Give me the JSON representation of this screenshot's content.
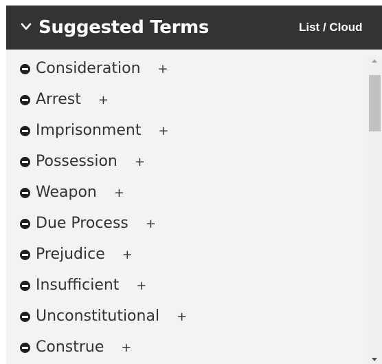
{
  "header": {
    "title": "Suggested Terms",
    "toggle_label": "List / Cloud",
    "collapse_icon": "chevron-down-icon"
  },
  "terms": [
    {
      "label": "Consideration",
      "add": "+"
    },
    {
      "label": "Arrest",
      "add": "+"
    },
    {
      "label": "Imprisonment",
      "add": "+"
    },
    {
      "label": "Possession",
      "add": "+"
    },
    {
      "label": "Weapon",
      "add": "+"
    },
    {
      "label": "Due Process",
      "add": "+"
    },
    {
      "label": "Prejudice",
      "add": "+"
    },
    {
      "label": "Insufficient",
      "add": "+"
    },
    {
      "label": "Unconstitutional",
      "add": "+"
    },
    {
      "label": "Construe",
      "add": "+"
    }
  ],
  "icons": {
    "remove": "minus-circle-icon",
    "scroll_up": "scroll-up-arrow-icon",
    "scroll_down": "scroll-down-arrow-icon"
  },
  "colors": {
    "header_bg": "#333333",
    "panel_bg": "#f3f3f3",
    "text": "#333333"
  }
}
